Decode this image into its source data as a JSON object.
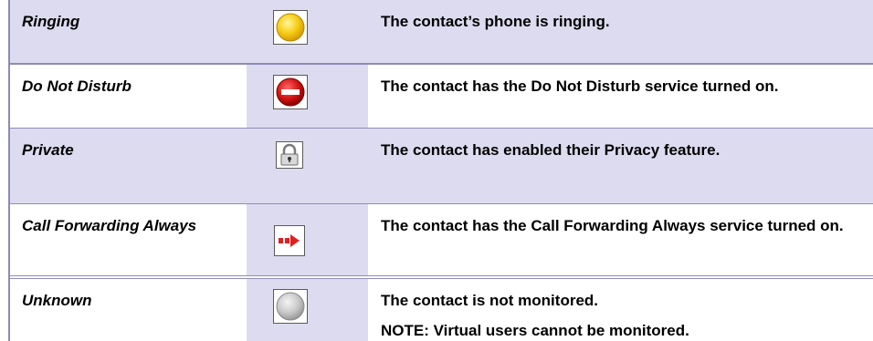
{
  "rows": [
    {
      "name": "Ringing",
      "icon": "yellow-circle-icon",
      "description": "The contact’s phone is ringing."
    },
    {
      "name": "Do Not Disturb",
      "icon": "no-entry-icon",
      "description": "The contact has the Do Not Disturb service turned on."
    },
    {
      "name": "Private",
      "icon": "padlock-icon",
      "description": "The contact has enabled their Privacy feature."
    },
    {
      "name": "Call Forwarding Always",
      "icon": "red-arrow-icon",
      "description": "The contact has the Call Forwarding Always service turned on."
    },
    {
      "name": "Unknown",
      "icon": "gray-circle-icon",
      "description": "The contact is not monitored.",
      "note": "NOTE:  Virtual users cannot be monitored."
    }
  ],
  "colors": {
    "row_shade": "#dddbef",
    "border": "#8f8bb8",
    "ringing": "#f5c400",
    "dnd": "#d01010",
    "forward": "#e02020",
    "unknown": "#c8c8c8"
  }
}
